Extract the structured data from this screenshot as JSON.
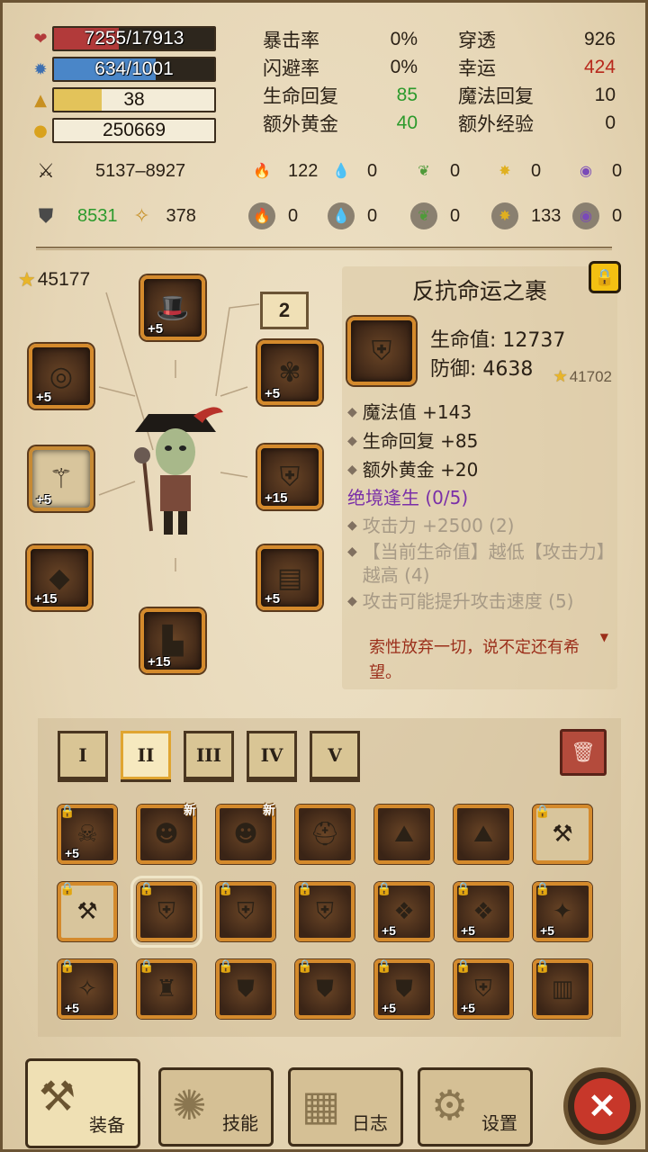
{
  "vitals": {
    "hp": "7255/17913",
    "hp_fill": 0.405,
    "mp": "634/1001",
    "mp_fill": 0.633,
    "level": "38",
    "level_fill": 0.3,
    "gold": "250669"
  },
  "stats": [
    {
      "label": "暴击率",
      "value": "0%",
      "label2": "穿透",
      "value2": "926",
      "color2": "#2b2116"
    },
    {
      "label": "闪避率",
      "value": "0%",
      "label2": "幸运",
      "value2": "424",
      "color2": "#b8281c"
    },
    {
      "label": "生命回复",
      "value": "85",
      "value_color": "#2c9a2c",
      "label2": "魔法回复",
      "value2": "10",
      "color2": "#2b2116"
    },
    {
      "label": "额外黄金",
      "value": "40",
      "value_color": "#2c9a2c",
      "label2": "额外经验",
      "value2": "0",
      "color2": "#2b2116"
    }
  ],
  "attack": "5137–8927",
  "defense": "8531",
  "magic_power": "378",
  "damage_row": [
    "122",
    "0",
    "0",
    "0",
    "0"
  ],
  "resist_row": [
    "0",
    "0",
    "0",
    "133",
    "0"
  ],
  "power_score": "45177",
  "tier_badge": "2",
  "equipped": [
    {
      "name": "hat",
      "plus": "+5"
    },
    {
      "name": "ring",
      "plus": "+5"
    },
    {
      "name": "amulet",
      "plus": "+5"
    },
    {
      "name": "staff",
      "plus": "+5"
    },
    {
      "name": "chest",
      "plus": "+15"
    },
    {
      "name": "bracer",
      "plus": "+15"
    },
    {
      "name": "belt",
      "plus": "+5"
    },
    {
      "name": "boots",
      "plus": "+15"
    }
  ],
  "detail": {
    "title": "反抗命运之裹",
    "hp": "生命值: 12737",
    "def": "防御: 4638",
    "score": "41702",
    "bonuses": [
      "魔法值 +143",
      "生命回复 +85",
      "额外黄金 +20"
    ],
    "set_name": "绝境逢生 (0/5)",
    "set_effects": [
      "攻击力 +2500 (2)",
      "【当前生命值】越低【攻击力】越高 (4)",
      "攻击可能提升攻击速度 (5)"
    ],
    "flavor": "索性放弃一切，说不定还有希望。"
  },
  "tabs": [
    "I",
    "II",
    "III",
    "IV",
    "V"
  ],
  "active_tab": 1,
  "inventory": [
    [
      {
        "p": "+5",
        "l": true
      },
      {
        "n": "新"
      },
      {
        "n": "新"
      },
      {},
      {},
      {},
      {
        "l": true,
        "empty": true
      }
    ],
    [
      {
        "l": true,
        "empty": true
      },
      {
        "l": true,
        "sel": true
      },
      {
        "l": true
      },
      {
        "l": true
      },
      {
        "l": true,
        "p": "+5"
      },
      {
        "l": true,
        "p": "+5"
      },
      {
        "l": true,
        "p": "+5"
      }
    ],
    [
      {
        "l": true,
        "p": "+5"
      },
      {
        "l": true
      },
      {
        "l": true
      },
      {
        "l": true
      },
      {
        "l": true,
        "p": "+5"
      },
      {
        "l": true,
        "p": "+5"
      },
      {
        "l": true
      }
    ]
  ],
  "nav": [
    "装备",
    "技能",
    "日志",
    "设置"
  ],
  "colors": {
    "hp": "#b23a3a",
    "mp": "#4a86c8",
    "xp": "#e3c35a",
    "slot_border": "#d48a2c"
  }
}
